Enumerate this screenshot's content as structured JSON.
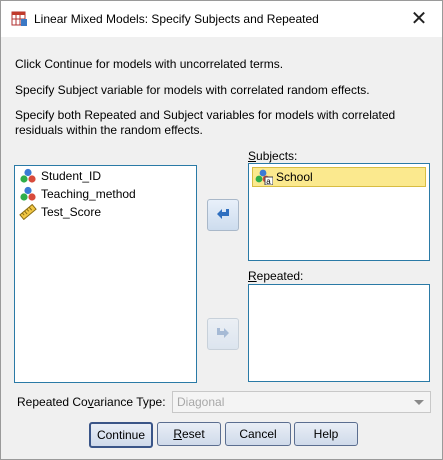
{
  "window": {
    "title": "Linear Mixed Models: Specify Subjects and Repeated",
    "close_glyph": "✕"
  },
  "instructions": {
    "line1": "Click Continue for models with uncorrelated terms.",
    "line2": "Specify Subject variable for models with correlated random effects.",
    "line3": "Specify both Repeated and Subject variables for models with correlated residuals within the random effects."
  },
  "variables": [
    {
      "label": "Student_ID",
      "icon": "nominal-variable-icon"
    },
    {
      "label": "Teaching_method",
      "icon": "nominal-variable-icon"
    },
    {
      "label": "Test_Score",
      "icon": "scale-variable-icon"
    }
  ],
  "subjects": {
    "label_prefix": "",
    "label_underlined": "S",
    "label_suffix": "ubjects:",
    "items": [
      {
        "label": "School",
        "icon": "nominal-string-variable-icon"
      }
    ]
  },
  "repeated": {
    "label_prefix": "",
    "label_underlined": "R",
    "label_suffix": "epeated:",
    "items": []
  },
  "covariance": {
    "label_prefix": "Repeated Co",
    "label_underlined": "v",
    "label_suffix": "ariance Type:",
    "value": "Diagonal",
    "enabled": false
  },
  "buttons": {
    "continue": {
      "pre": "Continue",
      "u": "",
      "post": ""
    },
    "reset": {
      "pre": "",
      "u": "R",
      "post": "eset"
    },
    "cancel": {
      "pre": "Cancel",
      "u": "",
      "post": ""
    },
    "help": {
      "pre": "Help",
      "u": "",
      "post": ""
    }
  },
  "colors": {
    "list_border": "#2a7aa6",
    "selection_fill": "#fbe98e",
    "arrow_blue": "#2f6fbf"
  }
}
